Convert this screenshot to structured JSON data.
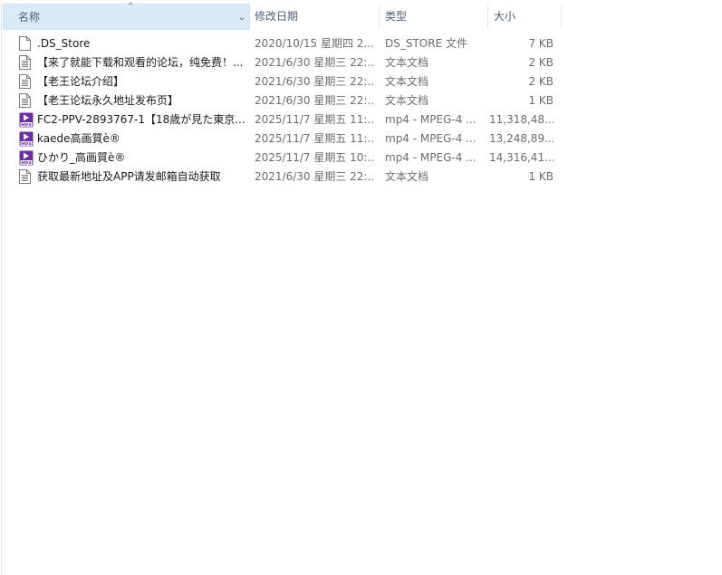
{
  "columns": {
    "name": "名称",
    "date": "修改日期",
    "type": "类型",
    "size": "大小"
  },
  "icons": {
    "sort": "sort-up-arrow-icon",
    "dropdown": "chevron-down-icon",
    "file": "document-icon",
    "video": "mp4-video-icon"
  },
  "colors": {
    "header_selected_bg": "#d9ebf9",
    "video_icon": "#6a2fa3"
  },
  "files": [
    {
      "icon": "file",
      "name": ".DS_Store",
      "date": "2020/10/15 星期四 2...",
      "type": "DS_STORE 文件",
      "size": "7 KB"
    },
    {
      "icon": "doc",
      "name": "【来了就能下载和观看的论坛，纯免费！...",
      "date": "2021/6/30 星期三 22:...",
      "type": "文本文档",
      "size": "2 KB"
    },
    {
      "icon": "doc",
      "name": "【老王论坛介绍】",
      "date": "2021/6/30 星期三 22:...",
      "type": "文本文档",
      "size": "2 KB"
    },
    {
      "icon": "doc",
      "name": "【老王论坛永久地址发布页】",
      "date": "2021/6/30 星期三 22:...",
      "type": "文本文档",
      "size": "1 KB"
    },
    {
      "icon": "video",
      "name": "FC2-PPV-2893767-1【18歳が見た東京...",
      "date": "2025/11/7 星期五 11:...",
      "type": "mp4 - MPEG-4 ...",
      "size": "11,318,48..."
    },
    {
      "icon": "video",
      "name": "kaede高画質è®",
      "date": "2025/11/7 星期五 11:...",
      "type": "mp4 - MPEG-4 ...",
      "size": "13,248,89..."
    },
    {
      "icon": "video",
      "name": "ひかり_高画質è®",
      "date": "2025/11/7 星期五 10:...",
      "type": "mp4 - MPEG-4 ...",
      "size": "14,316,41..."
    },
    {
      "icon": "doc",
      "name": "获取最新地址及APP请发邮箱自动获取",
      "date": "2021/6/30 星期三 22:...",
      "type": "文本文档",
      "size": "1 KB"
    }
  ]
}
